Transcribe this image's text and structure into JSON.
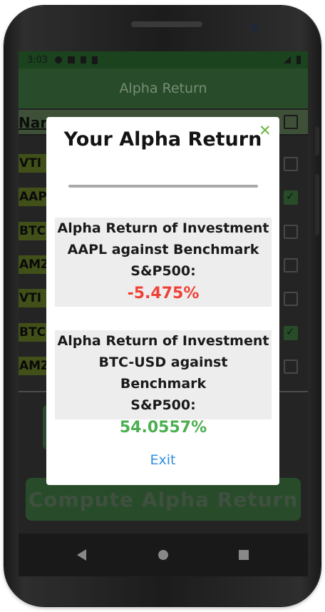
{
  "status_bar": {
    "time": "3:03"
  },
  "app_bar": {
    "title": "Alpha Return"
  },
  "table": {
    "header_name": "Nar",
    "rows": [
      {
        "ticker": "VTI",
        "checked": false
      },
      {
        "ticker": "AAPL",
        "checked": true
      },
      {
        "ticker": "BTC",
        "checked": false
      },
      {
        "ticker": "AMZ",
        "checked": false
      },
      {
        "ticker": "VTI",
        "checked": false
      },
      {
        "ticker": "BTC",
        "checked": true
      },
      {
        "ticker": "AMZ",
        "checked": false
      }
    ]
  },
  "compute_button": {
    "label": "Compute Alpha Return"
  },
  "dialog": {
    "title": "Your Alpha Return",
    "results": [
      {
        "line1": "Alpha Return of Investment",
        "line2": "AAPL against Benchmark",
        "line3": "S&P500:",
        "value": "-5.475%",
        "color": "#ef4136"
      },
      {
        "line1": "Alpha Return of Investment",
        "line2": "BTC-USD against Benchmark",
        "line3": "S&P500:",
        "value": "54.0557%",
        "color": "#4caf50"
      }
    ],
    "exit_label": "Exit"
  },
  "colors": {
    "primary_green": "#2f5a31",
    "accent_green": "#6cb343",
    "link_blue": "#2f8ee0"
  }
}
